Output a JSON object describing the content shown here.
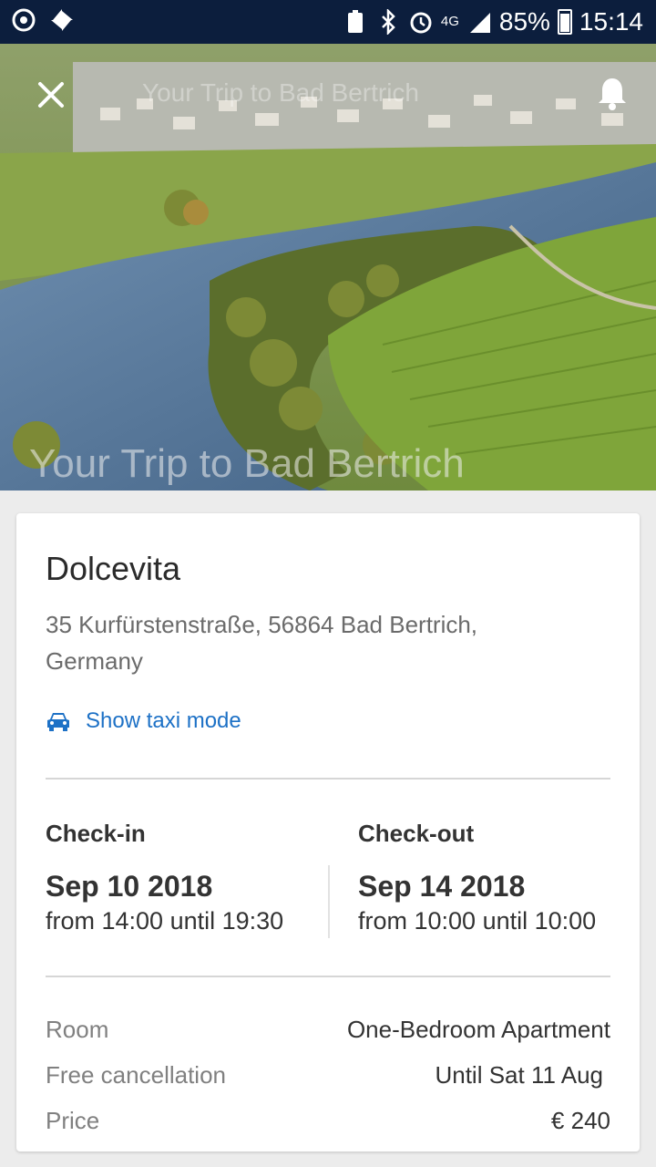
{
  "status_bar": {
    "battery": "85%",
    "time": "15:14",
    "network": "4G"
  },
  "toolbar": {
    "title": "Your Trip to Bad Bertrich"
  },
  "hero": {
    "title": "Your Trip to Bad Bertrich"
  },
  "booking": {
    "hotel_name": "Dolcevita",
    "address": "35 Kurfürstenstraße, 56864 Bad Bertrich, Germany",
    "taxi_label": "Show taxi mode",
    "checkin": {
      "heading": "Check-in",
      "date": "Sep 10 2018",
      "time": "from 14:00 until 19:30"
    },
    "checkout": {
      "heading": "Check-out",
      "date": "Sep 14 2018",
      "time": "from 10:00 until 10:00"
    },
    "details": [
      {
        "label": "Room",
        "value": "One-Bedroom Apartment"
      },
      {
        "label": "Free cancellation",
        "value": "Until Sat 11 Aug"
      },
      {
        "label": "Price",
        "value": "€ 240"
      }
    ]
  },
  "colors": {
    "status_bar": "#0c1e3d",
    "link": "#1d71c6"
  }
}
